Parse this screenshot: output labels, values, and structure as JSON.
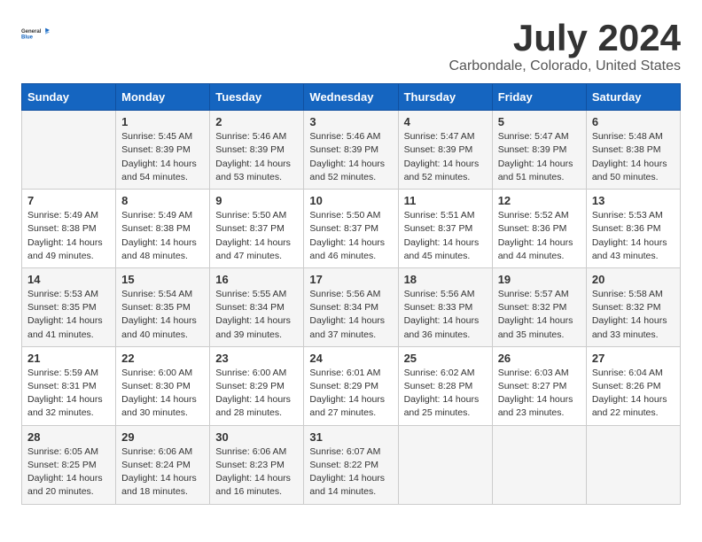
{
  "logo": {
    "general": "General",
    "blue": "Blue"
  },
  "header": {
    "title": "July 2024",
    "subtitle": "Carbondale, Colorado, United States"
  },
  "calendar": {
    "weekdays": [
      "Sunday",
      "Monday",
      "Tuesday",
      "Wednesday",
      "Thursday",
      "Friday",
      "Saturday"
    ],
    "weeks": [
      [
        {
          "day": "",
          "info": ""
        },
        {
          "day": "1",
          "info": "Sunrise: 5:45 AM\nSunset: 8:39 PM\nDaylight: 14 hours\nand 54 minutes."
        },
        {
          "day": "2",
          "info": "Sunrise: 5:46 AM\nSunset: 8:39 PM\nDaylight: 14 hours\nand 53 minutes."
        },
        {
          "day": "3",
          "info": "Sunrise: 5:46 AM\nSunset: 8:39 PM\nDaylight: 14 hours\nand 52 minutes."
        },
        {
          "day": "4",
          "info": "Sunrise: 5:47 AM\nSunset: 8:39 PM\nDaylight: 14 hours\nand 52 minutes."
        },
        {
          "day": "5",
          "info": "Sunrise: 5:47 AM\nSunset: 8:39 PM\nDaylight: 14 hours\nand 51 minutes."
        },
        {
          "day": "6",
          "info": "Sunrise: 5:48 AM\nSunset: 8:38 PM\nDaylight: 14 hours\nand 50 minutes."
        }
      ],
      [
        {
          "day": "7",
          "info": "Sunrise: 5:49 AM\nSunset: 8:38 PM\nDaylight: 14 hours\nand 49 minutes."
        },
        {
          "day": "8",
          "info": "Sunrise: 5:49 AM\nSunset: 8:38 PM\nDaylight: 14 hours\nand 48 minutes."
        },
        {
          "day": "9",
          "info": "Sunrise: 5:50 AM\nSunset: 8:37 PM\nDaylight: 14 hours\nand 47 minutes."
        },
        {
          "day": "10",
          "info": "Sunrise: 5:50 AM\nSunset: 8:37 PM\nDaylight: 14 hours\nand 46 minutes."
        },
        {
          "day": "11",
          "info": "Sunrise: 5:51 AM\nSunset: 8:37 PM\nDaylight: 14 hours\nand 45 minutes."
        },
        {
          "day": "12",
          "info": "Sunrise: 5:52 AM\nSunset: 8:36 PM\nDaylight: 14 hours\nand 44 minutes."
        },
        {
          "day": "13",
          "info": "Sunrise: 5:53 AM\nSunset: 8:36 PM\nDaylight: 14 hours\nand 43 minutes."
        }
      ],
      [
        {
          "day": "14",
          "info": "Sunrise: 5:53 AM\nSunset: 8:35 PM\nDaylight: 14 hours\nand 41 minutes."
        },
        {
          "day": "15",
          "info": "Sunrise: 5:54 AM\nSunset: 8:35 PM\nDaylight: 14 hours\nand 40 minutes."
        },
        {
          "day": "16",
          "info": "Sunrise: 5:55 AM\nSunset: 8:34 PM\nDaylight: 14 hours\nand 39 minutes."
        },
        {
          "day": "17",
          "info": "Sunrise: 5:56 AM\nSunset: 8:34 PM\nDaylight: 14 hours\nand 37 minutes."
        },
        {
          "day": "18",
          "info": "Sunrise: 5:56 AM\nSunset: 8:33 PM\nDaylight: 14 hours\nand 36 minutes."
        },
        {
          "day": "19",
          "info": "Sunrise: 5:57 AM\nSunset: 8:32 PM\nDaylight: 14 hours\nand 35 minutes."
        },
        {
          "day": "20",
          "info": "Sunrise: 5:58 AM\nSunset: 8:32 PM\nDaylight: 14 hours\nand 33 minutes."
        }
      ],
      [
        {
          "day": "21",
          "info": "Sunrise: 5:59 AM\nSunset: 8:31 PM\nDaylight: 14 hours\nand 32 minutes."
        },
        {
          "day": "22",
          "info": "Sunrise: 6:00 AM\nSunset: 8:30 PM\nDaylight: 14 hours\nand 30 minutes."
        },
        {
          "day": "23",
          "info": "Sunrise: 6:00 AM\nSunset: 8:29 PM\nDaylight: 14 hours\nand 28 minutes."
        },
        {
          "day": "24",
          "info": "Sunrise: 6:01 AM\nSunset: 8:29 PM\nDaylight: 14 hours\nand 27 minutes."
        },
        {
          "day": "25",
          "info": "Sunrise: 6:02 AM\nSunset: 8:28 PM\nDaylight: 14 hours\nand 25 minutes."
        },
        {
          "day": "26",
          "info": "Sunrise: 6:03 AM\nSunset: 8:27 PM\nDaylight: 14 hours\nand 23 minutes."
        },
        {
          "day": "27",
          "info": "Sunrise: 6:04 AM\nSunset: 8:26 PM\nDaylight: 14 hours\nand 22 minutes."
        }
      ],
      [
        {
          "day": "28",
          "info": "Sunrise: 6:05 AM\nSunset: 8:25 PM\nDaylight: 14 hours\nand 20 minutes."
        },
        {
          "day": "29",
          "info": "Sunrise: 6:06 AM\nSunset: 8:24 PM\nDaylight: 14 hours\nand 18 minutes."
        },
        {
          "day": "30",
          "info": "Sunrise: 6:06 AM\nSunset: 8:23 PM\nDaylight: 14 hours\nand 16 minutes."
        },
        {
          "day": "31",
          "info": "Sunrise: 6:07 AM\nSunset: 8:22 PM\nDaylight: 14 hours\nand 14 minutes."
        },
        {
          "day": "",
          "info": ""
        },
        {
          "day": "",
          "info": ""
        },
        {
          "day": "",
          "info": ""
        }
      ]
    ]
  }
}
